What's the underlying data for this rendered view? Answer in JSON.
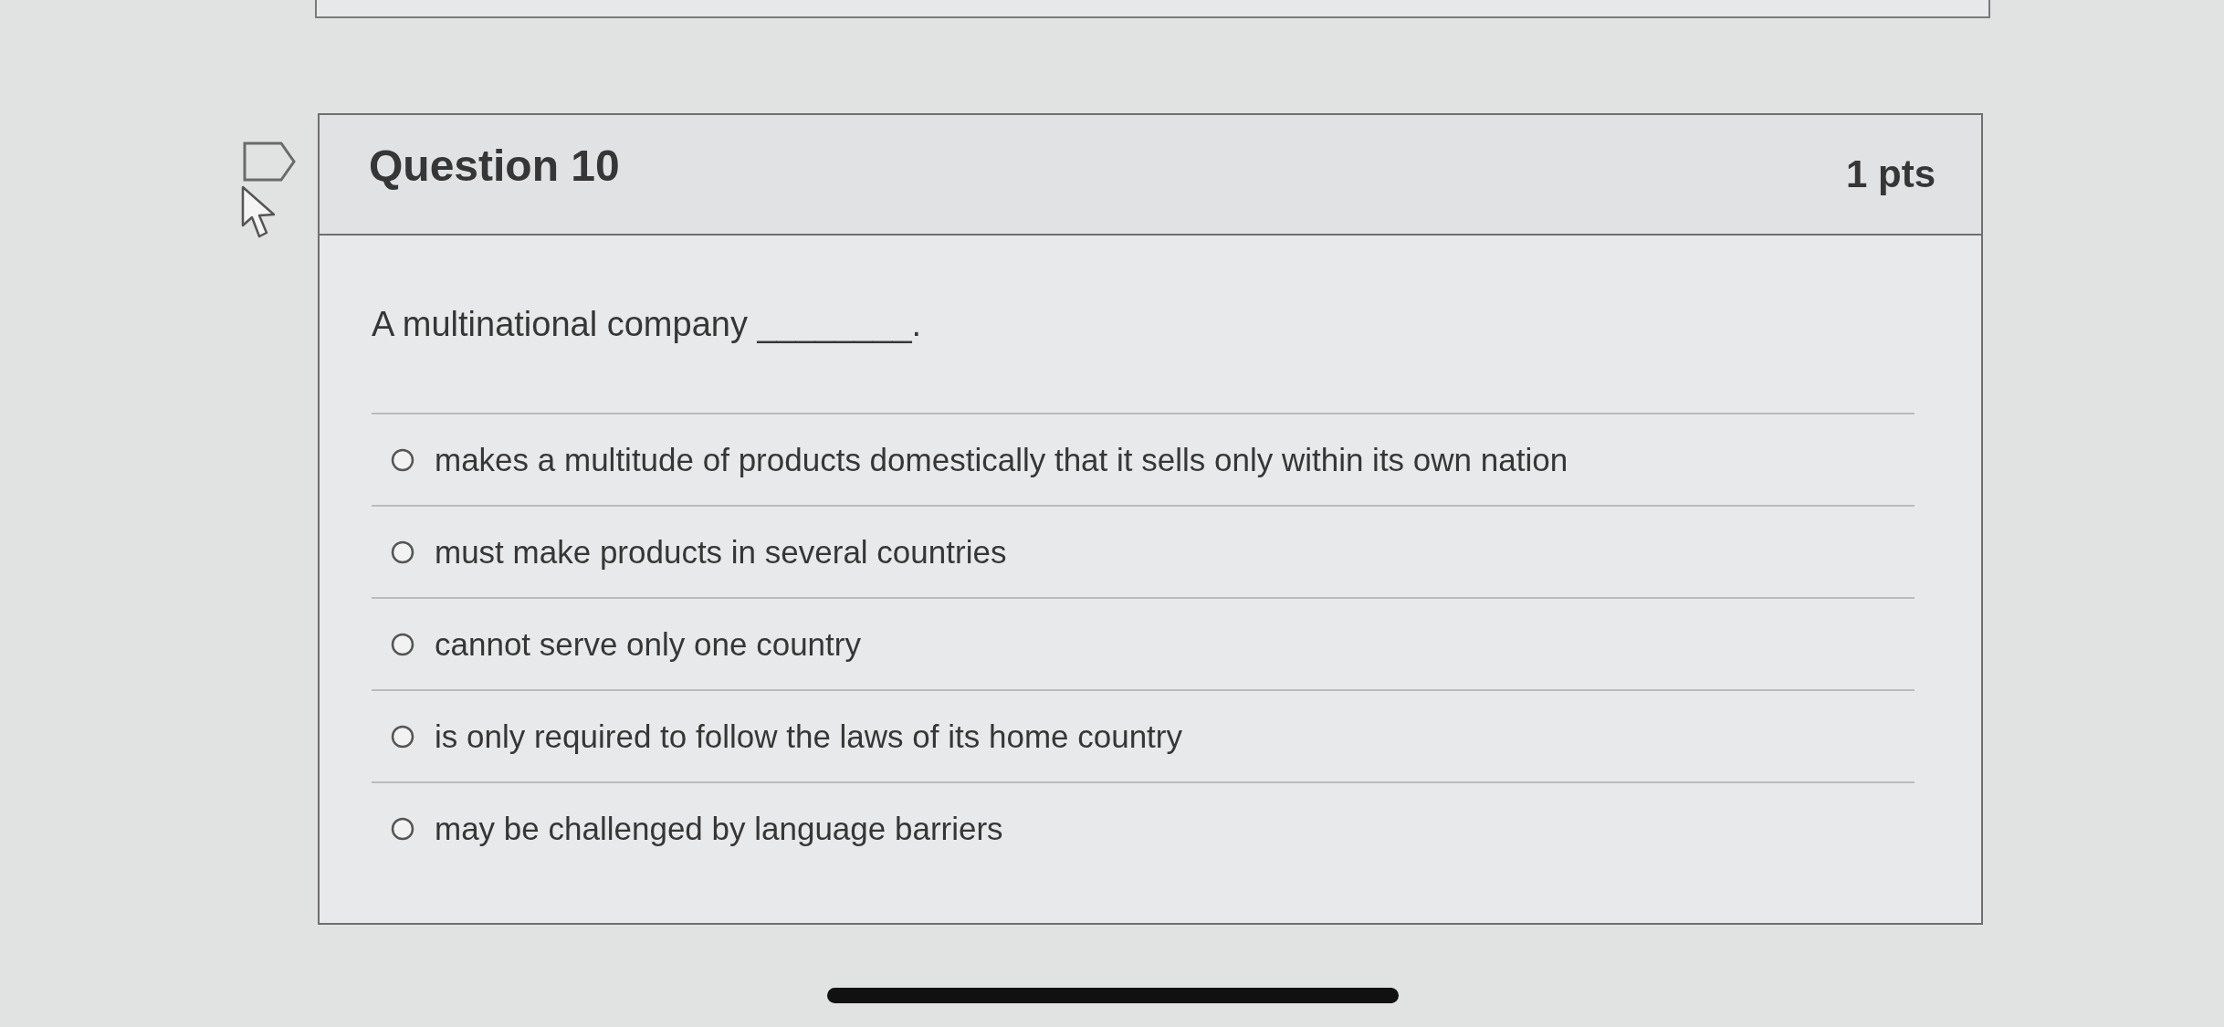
{
  "question": {
    "title": "Question 10",
    "points": "1 pts",
    "prompt": "A multinational company ________.",
    "answers": [
      {
        "label": "makes a multitude of products domestically that it sells only within its own nation",
        "selected": false
      },
      {
        "label": "must make products in several countries",
        "selected": false
      },
      {
        "label": "cannot serve only one country",
        "selected": false
      },
      {
        "label": "is only required to follow the laws of its home country",
        "selected": false
      },
      {
        "label": "may be challenged by language barriers",
        "selected": false
      }
    ]
  }
}
